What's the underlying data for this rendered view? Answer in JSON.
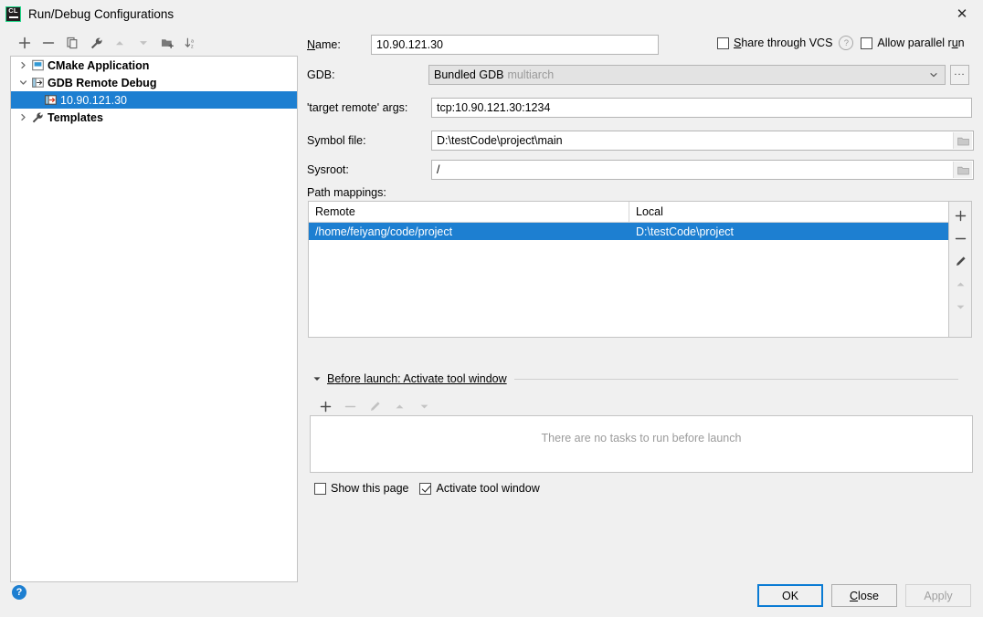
{
  "window": {
    "title": "Run/Debug Configurations",
    "logo_text": "CL",
    "close_icon": "✕"
  },
  "tree_toolbar": {
    "buttons": [
      {
        "name": "add",
        "icon": "plus-icon",
        "enabled": true
      },
      {
        "name": "remove",
        "icon": "minus-icon",
        "enabled": true
      },
      {
        "name": "copy",
        "icon": "copy-icon",
        "enabled": true
      },
      {
        "name": "edit-templates",
        "icon": "wrench-icon",
        "enabled": true
      },
      {
        "name": "move-up",
        "icon": "arrow-up-icon",
        "enabled": false
      },
      {
        "name": "move-down",
        "icon": "arrow-down-icon",
        "enabled": false
      },
      {
        "name": "new-folder",
        "icon": "folder-add-icon",
        "enabled": true
      },
      {
        "name": "sort-alphabetically",
        "icon": "sort-az-icon",
        "enabled": true
      }
    ]
  },
  "tree": {
    "items": [
      {
        "label": "CMake Application",
        "icon": "cmake-app-icon",
        "expanded": false,
        "level": 0,
        "selected": false,
        "bold": true
      },
      {
        "label": "GDB Remote Debug",
        "icon": "gdb-remote-icon",
        "expanded": true,
        "level": 0,
        "selected": false,
        "bold": true
      },
      {
        "label": "10.90.121.30",
        "icon": "gdb-remote-icon",
        "level": 1,
        "selected": true,
        "bold": false
      },
      {
        "label": "Templates",
        "icon": "wrench-icon",
        "expanded": false,
        "level": 0,
        "selected": false,
        "bold": true
      }
    ]
  },
  "form": {
    "name_label": "Name:",
    "name_mnemonic": "N",
    "name_value": "10.90.121.30",
    "share_vcs_label": "Share through VCS",
    "share_vcs_mnemonic": "S",
    "share_vcs_checked": false,
    "share_vcs_help": "?",
    "allow_parallel_label_pre": "Allow parallel r",
    "allow_parallel_mnemonic": "u",
    "allow_parallel_label_post": "n",
    "allow_parallel_checked": false,
    "gdb_label": "GDB:",
    "gdb_value": "Bundled GDB",
    "gdb_value_dim": "multiarch",
    "gdb_browse_label": "...",
    "target_remote_label": "'target remote' args:",
    "target_remote_value": "tcp:10.90.121.30:1234",
    "symbol_file_label": "Symbol file:",
    "symbol_file_value": "D:\\testCode\\project\\main",
    "sysroot_label": "Sysroot:",
    "sysroot_value": "/",
    "path_mappings_label": "Path mappings:"
  },
  "path_mappings": {
    "columns": [
      "Remote",
      "Local"
    ],
    "rows": [
      {
        "remote": "/home/feiyang/code/project",
        "local": "D:\\testCode\\project",
        "selected": true
      }
    ],
    "side_buttons": [
      {
        "name": "add-mapping",
        "icon": "plus-icon",
        "enabled": true
      },
      {
        "name": "remove-mapping",
        "icon": "minus-icon",
        "enabled": true
      },
      {
        "name": "edit-mapping",
        "icon": "pencil-icon",
        "enabled": true
      },
      {
        "name": "move-mapping-up",
        "icon": "arrow-up-icon",
        "enabled": false
      },
      {
        "name": "move-mapping-down",
        "icon": "arrow-down-icon",
        "enabled": false
      }
    ]
  },
  "before_launch": {
    "title_mnemonic": "B",
    "title_rest": "efore launch: Activate tool window",
    "expanded": true,
    "toolbar": [
      {
        "name": "add-task",
        "icon": "plus-icon",
        "enabled": true
      },
      {
        "name": "remove-task",
        "icon": "minus-icon",
        "enabled": false
      },
      {
        "name": "edit-task",
        "icon": "pencil-icon",
        "enabled": false
      },
      {
        "name": "move-task-up",
        "icon": "arrow-up-icon",
        "enabled": false
      },
      {
        "name": "move-task-down",
        "icon": "arrow-down-icon",
        "enabled": false
      }
    ],
    "empty_text": "There are no tasks to run before launch",
    "show_page_label": "Show this page",
    "show_page_checked": false,
    "activate_tool_window_label": "Activate tool window",
    "activate_tool_window_checked": true
  },
  "footer": {
    "help_icon": "?",
    "ok_label": "OK",
    "close_label_pre": "",
    "close_mnemonic": "C",
    "close_label_post": "lose",
    "apply_label": "Apply",
    "apply_enabled": false
  },
  "colors": {
    "accent": "#1d7fd1",
    "window_bg": "#f0f0f0",
    "field_bg": "#ffffff",
    "logo_green": "#21d789",
    "default_button_border": "#0a7bd4"
  }
}
